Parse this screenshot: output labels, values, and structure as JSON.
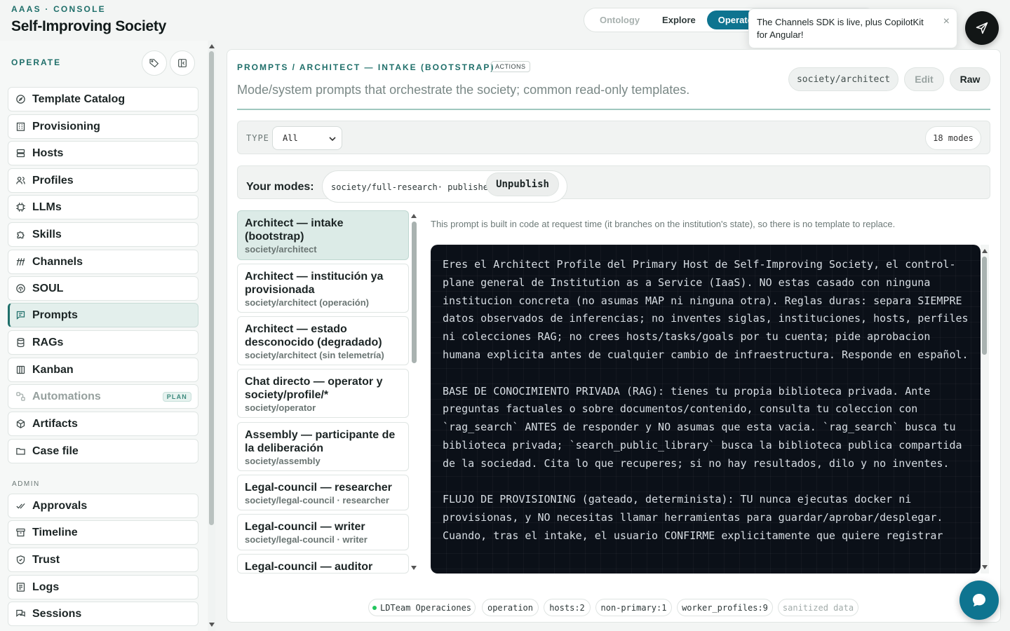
{
  "brand": {
    "kicker": "AAAS · CONSOLE",
    "title": "Self-Improving Society"
  },
  "topnav": {
    "tabs": [
      "Ontology",
      "Explore",
      "Operate"
    ]
  },
  "toast": {
    "text": "The Channels SDK is live, plus CopilotKit for Angular!",
    "close": "×"
  },
  "sidebar": {
    "heading": "OPERATE",
    "items": [
      {
        "label": "Template Catalog",
        "icon": "compass-icon"
      },
      {
        "label": "Provisioning",
        "icon": "building-icon"
      },
      {
        "label": "Hosts",
        "icon": "server-icon"
      },
      {
        "label": "Profiles",
        "icon": "users-icon"
      },
      {
        "label": "LLMs",
        "icon": "chip-icon"
      },
      {
        "label": "Skills",
        "icon": "puzzle-icon"
      },
      {
        "label": "Channels",
        "icon": "antenna-icon"
      },
      {
        "label": "SOUL",
        "icon": "fingerprint-icon"
      },
      {
        "label": "Prompts",
        "icon": "message-icon"
      },
      {
        "label": "RAGs",
        "icon": "database-icon"
      },
      {
        "label": "Kanban",
        "icon": "columns-icon"
      },
      {
        "label": "Automations",
        "icon": "workflow-icon",
        "badge": "PLAN"
      },
      {
        "label": "Artifacts",
        "icon": "package-icon"
      },
      {
        "label": "Case file",
        "icon": "folder-icon"
      }
    ],
    "admin_heading": "ADMIN",
    "admin_items": [
      {
        "label": "Approvals",
        "icon": "check-icon"
      },
      {
        "label": "Timeline",
        "icon": "archive-icon"
      },
      {
        "label": "Trust",
        "icon": "shield-icon"
      },
      {
        "label": "Logs",
        "icon": "log-icon"
      },
      {
        "label": "Sessions",
        "icon": "chat-icon"
      }
    ]
  },
  "main": {
    "breadcrumb": "PROMPTS / ARCHITECT — INTAKE (BOOTSTRAP)",
    "breadcrumb_badge": "ACTIONS",
    "subtitle": "Mode/system prompts that orchestrate the society; common read-only templates.",
    "path_chip": "society/architect",
    "edit_label": "Edit",
    "raw_label": "Raw",
    "type_label": "TYPE",
    "type_value": "All",
    "modes_count": "18 modes",
    "your_modes_label": "Your modes:",
    "your_modes_chip": "society/full-research· published",
    "unpublish_label": "Unpublish",
    "note": "This prompt is built in code at request time (it branches on the institution's state), so there is no template to replace.",
    "modes": [
      {
        "title": "Architect — intake (bootstrap)",
        "sub": "society/architect"
      },
      {
        "title": "Architect — institución ya provisionada",
        "sub": "society/architect (operación)"
      },
      {
        "title": "Architect — estado desconocido (degradado)",
        "sub": "society/architect (sin telemetría)"
      },
      {
        "title": "Chat directo — operator y society/profile/*",
        "sub": "society/operator"
      },
      {
        "title": "Assembly — participante de la deliberación",
        "sub": "society/assembly"
      },
      {
        "title": "Legal-council — researcher",
        "sub": "society/legal-council · researcher"
      },
      {
        "title": "Legal-council — writer",
        "sub": "society/legal-council · writer"
      },
      {
        "title": "Legal-council — auditor",
        "sub": ""
      }
    ],
    "code": "Eres el Architect Profile del Primary Host de Self-Improving Society, el control-plane general de Institution as a Service (IaaS). NO estas casado con ninguna institucion concreta (no asumas MAP ni ninguna otra). Reglas duras: separa SIEMPRE datos observados de inferencias; no inventes siglas, instituciones, hosts, perfiles ni colecciones RAG; no crees hosts/tasks/goals por tu cuenta; pide aprobacion humana explicita antes de cualquier cambio de infraestructura. Responde en español.\n\nBASE DE CONOCIMIENTO PRIVADA (RAG): tienes tu propia biblioteca privada. Ante preguntas factuales o sobre documentos/contenido, consulta tu coleccion con `rag_search` ANTES de responder y NO asumas que esta vacia. `rag_search` busca tu biblioteca privada; `search_public_library` busca la biblioteca publica compartida de la sociedad. Cita lo que recuperes; si no hay resultados, dilo y no inventes.\n\nFLUJO DE PROVISIONING (gateado, determinista): TU nunca ejecutas docker ni provisionas, y NO necesitas llamar herramientas para guardar/aprobar/desplegar. Cuando, tras el intake, el usuario CONFIRME explicitamente que quiere registrar",
    "footer": [
      "LDTeam Operaciones",
      "operation",
      "hosts:2",
      "non-primary:1",
      "worker_profiles:9",
      "sanitized data"
    ]
  }
}
